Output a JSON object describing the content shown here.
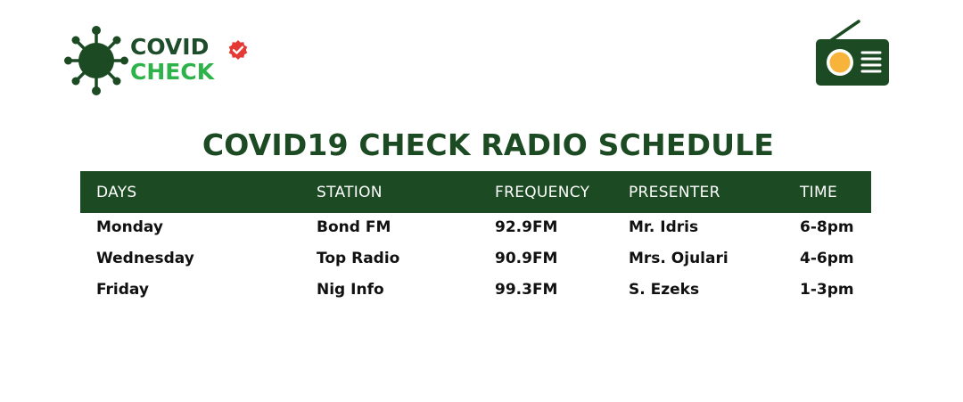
{
  "brand": {
    "word1": "COVID",
    "word2": "CHECK",
    "colors": {
      "dark_green": "#1b4a23",
      "green": "#2db34a",
      "badge_red": "#e53935",
      "radio_yellow": "#f8b33b"
    },
    "icons": [
      "virus-icon",
      "verified-badge-icon",
      "radio-icon"
    ]
  },
  "title": "COVID19 CHECK RADIO SCHEDULE",
  "schedule": {
    "headers": [
      "DAYS",
      "STATION",
      "FREQUENCY",
      "PRESENTER",
      "TIME"
    ],
    "rows": [
      [
        "Monday",
        "Bond FM",
        "92.9FM",
        "Mr. Idris",
        "6-8pm"
      ],
      [
        "Wednesday",
        "Top Radio",
        "90.9FM",
        "Mrs. Ojulari",
        "4-6pm"
      ],
      [
        "Friday",
        "Nig Info",
        "99.3FM",
        "S. Ezeks",
        "1-3pm"
      ]
    ]
  }
}
